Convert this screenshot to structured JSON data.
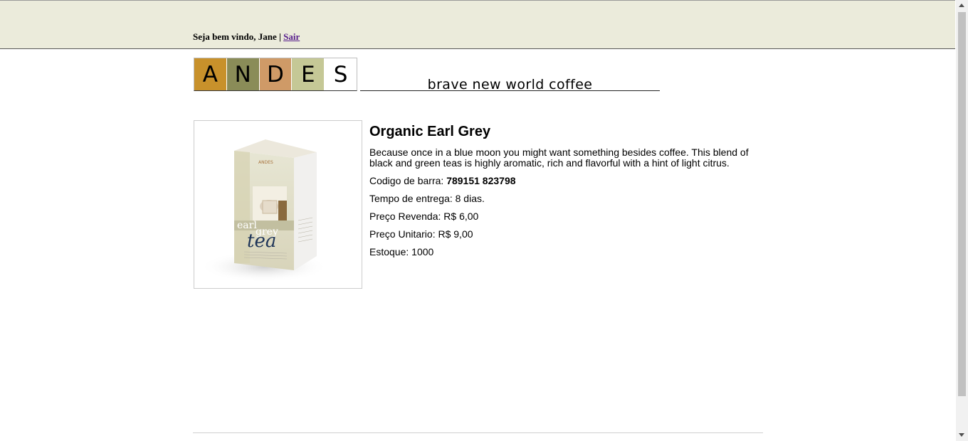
{
  "header": {
    "welcome_text": "Seja bem vindo, Jane",
    "separator": " | ",
    "logout_label": "Sair"
  },
  "logo": {
    "letters": [
      "A",
      "N",
      "D",
      "E",
      "S"
    ],
    "colors": [
      "#c8912b",
      "#8a8c58",
      "#cf9a67",
      "#c5c896",
      "#ffffff"
    ],
    "tagline": "brave new world coffee"
  },
  "product": {
    "name": "Organic Earl Grey",
    "description": "Because once in a blue moon you might want something besides coffee. This blend of black and green teas is highly aromatic, rich and flavorful with a hint of light citrus.",
    "barcode_label": "Codigo de barra:",
    "barcode_value": "789151 823798",
    "delivery_text": "Tempo de entrega: 8 dias.",
    "resale_price_text": "Preço Revenda: R$ 6,00",
    "unit_price_text": "Preço Unitario: R$ 9,00",
    "stock_text": "Estoque: 1000",
    "image": {
      "box_brand": "ANDES",
      "box_words": [
        "earl",
        "grey",
        "tea"
      ]
    }
  }
}
